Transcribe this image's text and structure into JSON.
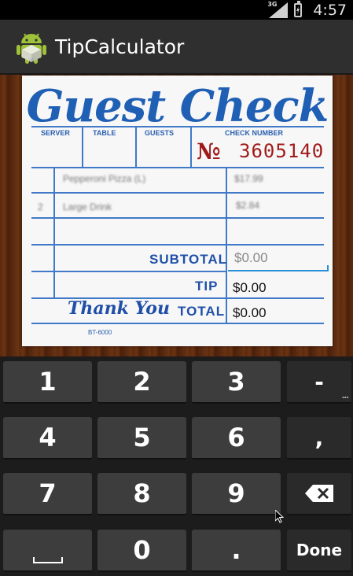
{
  "status_bar": {
    "network": "3G",
    "time": "4:57"
  },
  "app": {
    "title": "TipCalculator",
    "icon": "android-robot-icon"
  },
  "check": {
    "title": "Guest Check",
    "headers": {
      "server": "SERVER",
      "table": "TABLE",
      "guests": "GUESTS",
      "check_number": "CHECK NUMBER"
    },
    "number_sign": "№",
    "number": "3605140",
    "items": [
      {
        "qty": "",
        "name": "Pepperoni Pizza (L)",
        "price": "$17.99"
      },
      {
        "qty": "2",
        "name": "Large Drink",
        "price": "$2.84"
      }
    ],
    "subtotal_label": "SUBTOTAL",
    "subtotal_placeholder": "$0.00",
    "tip_label": "TIP",
    "tip_value": "$0.00",
    "thank_you": "Thank You",
    "total_label": "TOTAL",
    "total_value": "$0.00",
    "form_number": "BT-6000"
  },
  "keyboard": {
    "keys": [
      "1",
      "2",
      "3",
      "-",
      "4",
      "5",
      "6",
      ",",
      "7",
      "8",
      "9",
      "0",
      "."
    ],
    "done_label": "Done"
  }
}
